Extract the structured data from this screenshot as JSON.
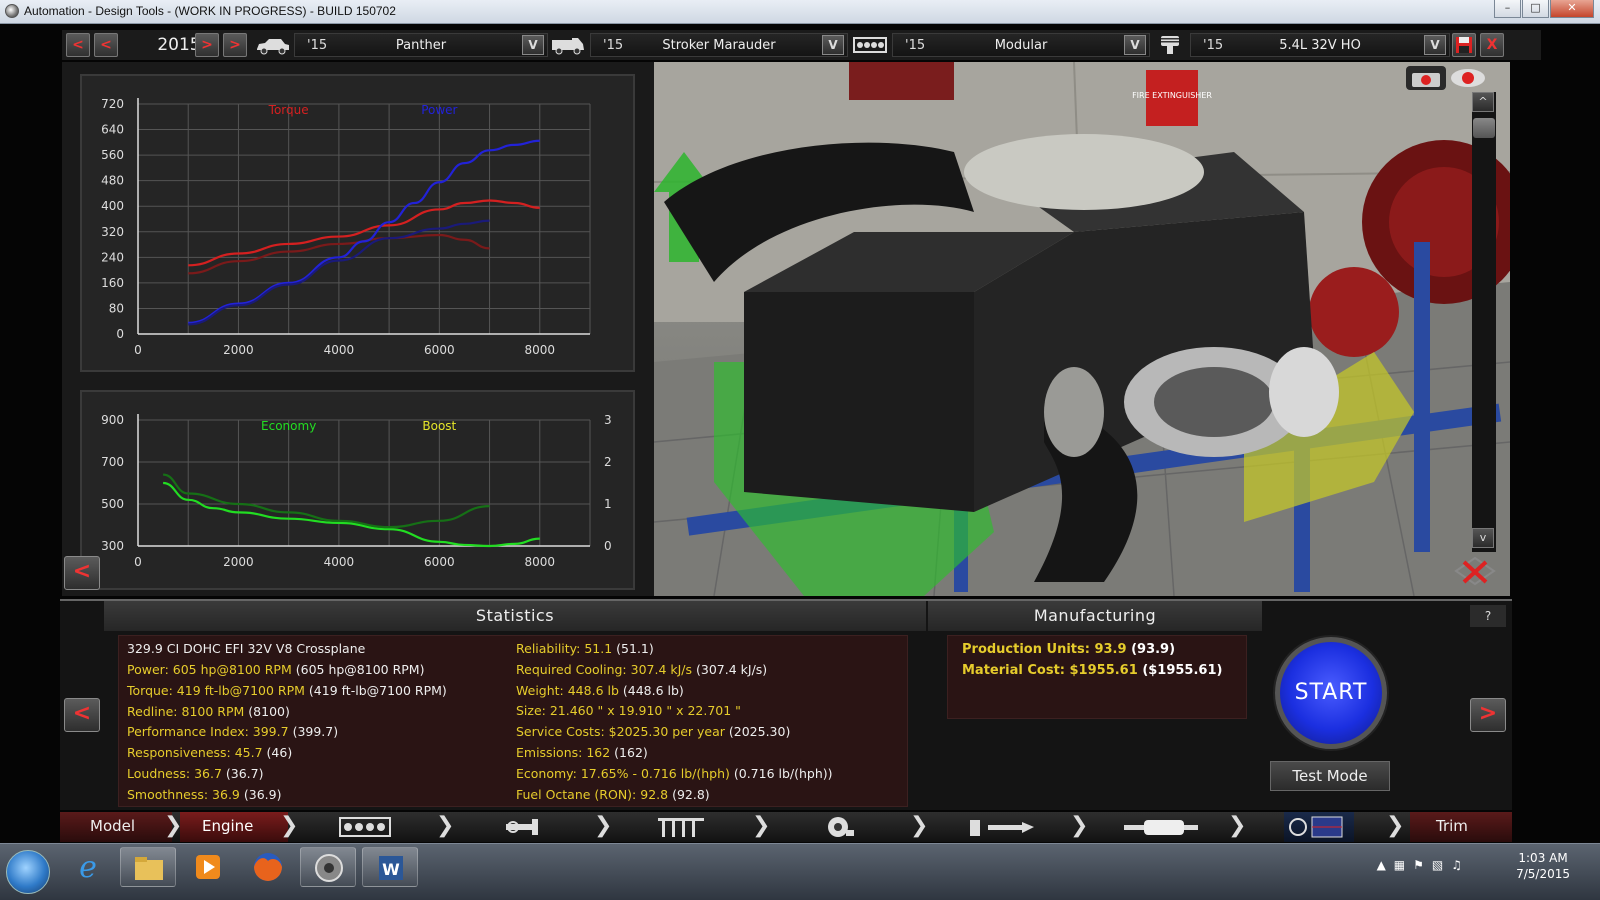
{
  "window": {
    "title": "Automation - Design Tools - (WORK IN PROGRESS) - BUILD 150702"
  },
  "topbar": {
    "year": "2015",
    "nav_buttons": [
      "<",
      "<",
      ">",
      ">"
    ],
    "selectors": [
      {
        "icon": "car-icon",
        "year": "'15",
        "name": "Panther",
        "drop": "V"
      },
      {
        "icon": "van-icon",
        "year": "'15",
        "name": "Stroker Marauder",
        "drop": "V"
      },
      {
        "icon": "engine-block-icon",
        "year": "'15",
        "name": "Modular",
        "drop": "V"
      },
      {
        "icon": "piston-icon",
        "year": "'15",
        "name": "5.4L 32V HO",
        "drop": "V"
      }
    ],
    "save_icon": "save-icon",
    "close_label": "X"
  },
  "chart_data": [
    {
      "type": "line",
      "legend": [
        "Torque",
        "Power"
      ],
      "x_ticks": [
        "0",
        "2000",
        "4000",
        "6000",
        "8000"
      ],
      "y_ticks": [
        "0",
        "80",
        "160",
        "240",
        "320",
        "400",
        "480",
        "560",
        "640",
        "720"
      ],
      "xlim": [
        0,
        9000
      ],
      "ylim": [
        0,
        720
      ],
      "series": [
        {
          "name": "Torque",
          "color": "#d42020",
          "x": [
            1000,
            2000,
            3000,
            4000,
            5000,
            6000,
            6500,
            7000,
            7500,
            8000
          ],
          "y": [
            215,
            252,
            282,
            305,
            340,
            390,
            410,
            418,
            410,
            395
          ]
        },
        {
          "color": "#7a1a1a",
          "x": [
            1000,
            2000,
            3000,
            4000,
            5000,
            6000,
            6500,
            7000
          ],
          "y": [
            190,
            228,
            258,
            282,
            300,
            310,
            295,
            268
          ]
        },
        {
          "name": "Power",
          "color": "#2222d8",
          "x": [
            1000,
            2000,
            3000,
            4000,
            4500,
            5000,
            5500,
            6000,
            6500,
            7000,
            7500,
            8000
          ],
          "y": [
            35,
            95,
            160,
            240,
            290,
            350,
            410,
            475,
            535,
            575,
            592,
            605
          ]
        },
        {
          "color": "#1a1a7a",
          "x": [
            1000,
            2000,
            3000,
            4000,
            5000,
            6000,
            6500,
            7000
          ],
          "y": [
            30,
            90,
            155,
            230,
            300,
            330,
            345,
            355
          ]
        }
      ]
    },
    {
      "type": "line",
      "legend": [
        "Economy",
        "Boost"
      ],
      "x_ticks": [
        "0",
        "2000",
        "4000",
        "6000",
        "8000"
      ],
      "y_ticks_left": [
        "300",
        "500",
        "700",
        "900"
      ],
      "y_ticks_right": [
        "0",
        "1",
        "2",
        "3"
      ],
      "xlim": [
        0,
        9000
      ],
      "ylim": [
        300,
        900
      ],
      "series": [
        {
          "name": "Economy",
          "color": "#22dd22",
          "x": [
            500,
            1000,
            1500,
            2000,
            3000,
            4000,
            5000,
            6000,
            6500,
            7000,
            7500,
            8000
          ],
          "y": [
            600,
            520,
            480,
            460,
            430,
            410,
            380,
            320,
            305,
            300,
            310,
            335
          ]
        },
        {
          "color": "#167016",
          "x": [
            500,
            1000,
            2000,
            3000,
            4000,
            5000,
            6000,
            7000
          ],
          "y": [
            640,
            550,
            500,
            460,
            420,
            390,
            420,
            490
          ]
        }
      ]
    }
  ],
  "statistics": {
    "header": "Statistics",
    "engine_name": "329.9 CI DOHC EFI 32V V8 Crossplane",
    "left": [
      {
        "label": "Power: 605 hp@8100 RPM",
        "value": "(605 hp@8100 RPM)"
      },
      {
        "label": "Torque: 419 ft-lb@7100 RPM",
        "value": "(419 ft-lb@7100 RPM)"
      },
      {
        "label": "Redline: 8100 RPM",
        "value": "(8100)"
      },
      {
        "label": "Performance Index: 399.7",
        "value": "(399.7)"
      },
      {
        "label": "Responsiveness: 45.7",
        "value": "(46)"
      },
      {
        "label": "Loudness: 36.7",
        "value": "(36.7)"
      },
      {
        "label": "Smoothness: 36.9",
        "value": "(36.9)"
      }
    ],
    "right": [
      {
        "label": "Reliability: 51.1",
        "value": "(51.1)"
      },
      {
        "label": "Required Cooling: 307.4 kJ/s",
        "value": "(307.4 kJ/s)"
      },
      {
        "label": "Weight: 448.6 lb",
        "value": "(448.6 lb)"
      },
      {
        "label": "Size: 21.460 \" x 19.910 \" x 22.701 \"",
        "value": ""
      },
      {
        "label": "Service Costs: $2025.30 per year",
        "value": "(2025.30)"
      },
      {
        "label": "Emissions: 162",
        "value": "(162)"
      },
      {
        "label": "Economy: 17.65% - 0.716 lb/(hph)",
        "value": "(0.716 lb/(hph))"
      },
      {
        "label": "Fuel Octane (RON): 92.8",
        "value": "(92.8)"
      }
    ]
  },
  "manufacturing": {
    "header": "Manufacturing",
    "rows": [
      {
        "label": "Production Units: 93.9",
        "value": "(93.9)"
      },
      {
        "label": "Material Cost: $1955.61",
        "value": "($1955.61)"
      }
    ]
  },
  "controls": {
    "start": "START",
    "test_mode": "Test Mode",
    "help": "?",
    "prev": "<",
    "next": ">"
  },
  "viewport": {
    "scroll_up": "^",
    "scroll_down": "v",
    "sign_text": "FIRE EXTINGUISHER"
  },
  "navbar": {
    "items": [
      {
        "label": "Model",
        "icon": ""
      },
      {
        "label": "Engine",
        "icon": ""
      },
      {
        "label": "",
        "icon": "engine-block-icon"
      },
      {
        "label": "",
        "icon": "crank-icon"
      },
      {
        "label": "",
        "icon": "valvetrain-icon"
      },
      {
        "label": "",
        "icon": "turbo-icon"
      },
      {
        "label": "",
        "icon": "fuel-system-icon"
      },
      {
        "label": "",
        "icon": "exhaust-icon"
      },
      {
        "label": "",
        "icon": "tuning-icon"
      },
      {
        "label": "Trim",
        "icon": ""
      }
    ]
  },
  "taskbar": {
    "time": "1:03 AM",
    "date": "7/5/2015"
  }
}
